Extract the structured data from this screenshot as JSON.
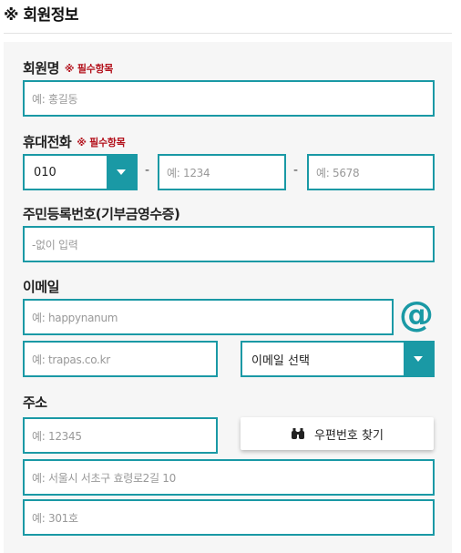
{
  "section": {
    "title": "※ 회원정보"
  },
  "name": {
    "label": "회원명",
    "required": "※ 필수항목",
    "placeholder": "예: 홍길동"
  },
  "phone": {
    "label": "휴대전화",
    "required": "※ 필수항목",
    "prefix": "010",
    "dash": "-",
    "mid_placeholder": "예: 1234",
    "last_placeholder": "예: 5678"
  },
  "rrn": {
    "label": "주민등록번호(기부금영수증)",
    "placeholder": "-없이 입력"
  },
  "email": {
    "label": "이메일",
    "id_placeholder": "예: happynanum",
    "at": "@",
    "domain_placeholder": "예: trapas.co.kr",
    "select_label": "이메일 선택"
  },
  "address": {
    "label": "주소",
    "zip_placeholder": "예: 12345",
    "zip_button": "우편번호 찾기",
    "addr1_placeholder": "예: 서울시 서초구 효령로2길 10",
    "addr2_placeholder": "예: 301호"
  },
  "colors": {
    "accent": "#1a99a5",
    "required": "#b3101b"
  }
}
